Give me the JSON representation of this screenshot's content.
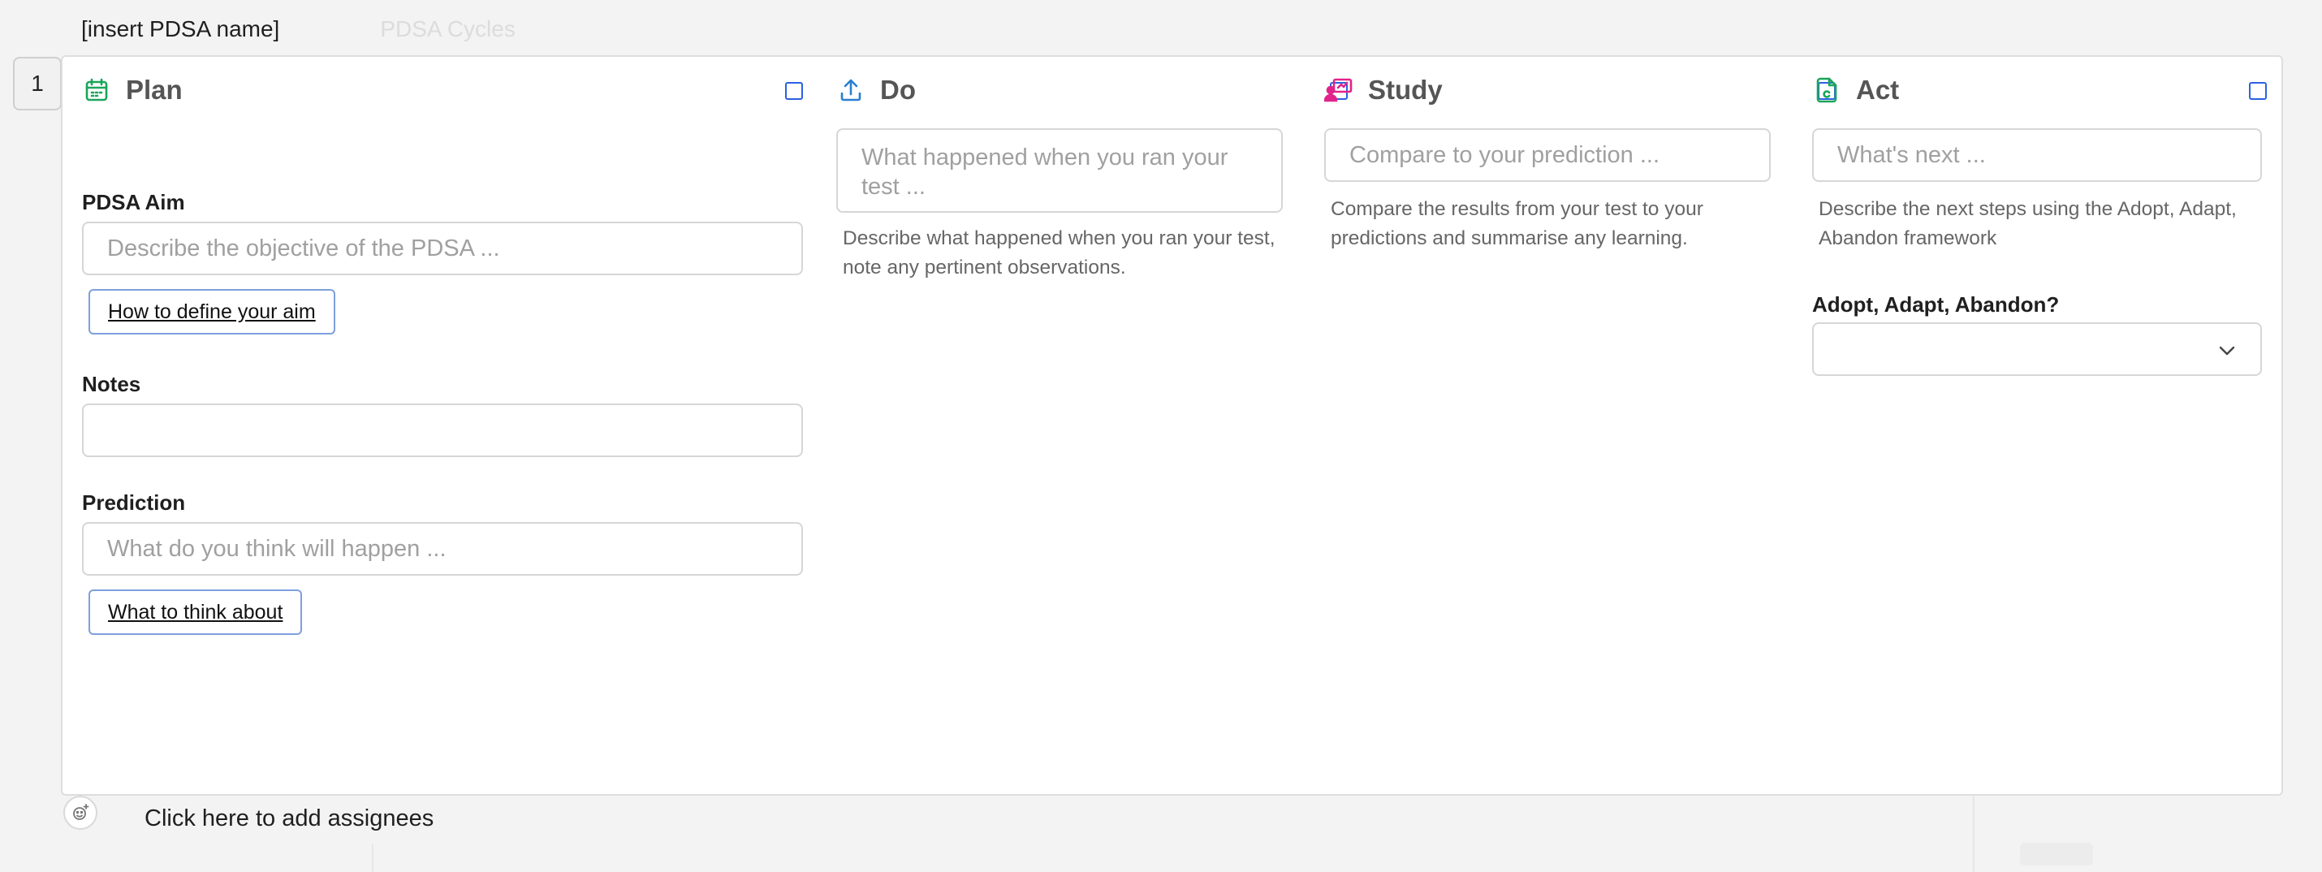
{
  "header": {
    "pdsa_name": "[insert PDSA name]",
    "cycles_label": "PDSA Cycles"
  },
  "row": {
    "number": "1"
  },
  "columns": {
    "plan": {
      "title": "Plan",
      "icon": "calendar-icon",
      "color": "#1aa55a",
      "aim_label": "PDSA Aim",
      "aim_placeholder": "Describe the objective of the PDSA ...",
      "aim_help": "How to define your aim",
      "notes_label": "Notes",
      "notes_placeholder": "",
      "prediction_label": "Prediction",
      "prediction_placeholder": "What do you think will happen ...",
      "prediction_help": "What to think about"
    },
    "do": {
      "title": "Do",
      "icon": "upload-icon",
      "color": "#2a7fd0",
      "placeholder": "What happened when you ran your test ...",
      "description": "Describe what happened when you ran your test, note any pertinent observations."
    },
    "study": {
      "title": "Study",
      "icon": "presentation-user-icon",
      "color": "#e0248a",
      "placeholder": "Compare to your prediction ...",
      "description": "Compare the results from your test to your predictions and summarise any learning."
    },
    "act": {
      "title": "Act",
      "icon": "document-c-icon",
      "color": "#1aa55a",
      "placeholder": "What's next ...",
      "description": "Describe the next steps using the Adopt, Adapt, Abandon framework",
      "select_label": "Adopt, Adapt, Abandon?",
      "select_value": ""
    }
  },
  "footer": {
    "assignees_text": "Click here to add assignees",
    "assignee_icon": "add-person-icon"
  }
}
